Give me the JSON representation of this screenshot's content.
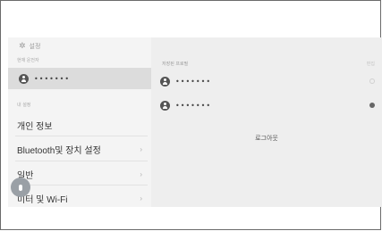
{
  "header": {
    "icon": "gear-icon",
    "title": "설정"
  },
  "sidebar": {
    "current_user_label": "현재 운전자",
    "current_user_name": "•••••••",
    "my_settings_label": "내 설정",
    "items": [
      {
        "label": "개인 정보",
        "has_chevron": false
      },
      {
        "label": "Bluetooth및 장치 설정",
        "chevron": "›"
      },
      {
        "label": "일반",
        "chevron": "›"
      },
      {
        "label": "미터 및 Wi-Fi",
        "chevron": "›"
      }
    ]
  },
  "main": {
    "saved_profiles_label": "저장된 프로필",
    "edit_label": "편집",
    "profiles": [
      {
        "name": "•••••••",
        "selected": false
      },
      {
        "name": "•••••••",
        "selected": true
      }
    ],
    "logout_label": "로그아웃"
  },
  "voice_button": {
    "icon": "microphone-icon"
  },
  "colors": {
    "screen_bg": "#f2f2f2",
    "selected_row_bg": "#dcdcdc",
    "text": "#333333",
    "muted": "#9a9a9a",
    "mic_button": "#9aa0a6"
  }
}
